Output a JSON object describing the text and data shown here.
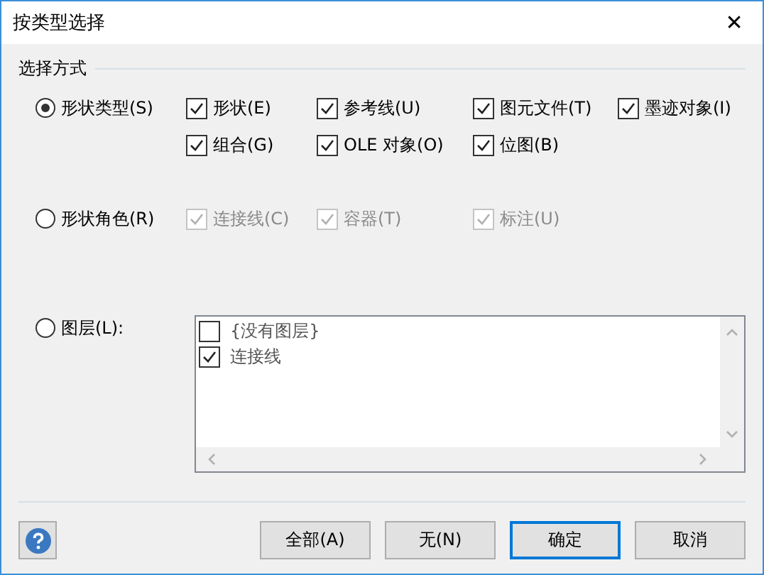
{
  "window": {
    "title": "按类型选择",
    "close": "✕"
  },
  "group": {
    "title": "选择方式"
  },
  "options": [
    {
      "label": "形状类型(S)",
      "selected": true,
      "checkboxes": [
        {
          "label": "形状(E)",
          "checked": true,
          "disabled": false
        },
        {
          "label": "参考线(U)",
          "checked": true,
          "disabled": false
        },
        {
          "label": "图元文件(T)",
          "checked": true,
          "disabled": false
        },
        {
          "label": "墨迹对象(I)",
          "checked": true,
          "disabled": false
        },
        {
          "label": "组合(G)",
          "checked": true,
          "disabled": false
        },
        {
          "label": "OLE 对象(O)",
          "checked": true,
          "disabled": false
        },
        {
          "label": "位图(B)",
          "checked": true,
          "disabled": false
        }
      ]
    },
    {
      "label": "形状角色(R)",
      "selected": false,
      "checkboxes": [
        {
          "label": "连接线(C)",
          "checked": true,
          "disabled": true
        },
        {
          "label": "容器(T)",
          "checked": true,
          "disabled": true
        },
        {
          "label": "标注(U)",
          "checked": true,
          "disabled": true
        }
      ]
    },
    {
      "label": "图层(L):",
      "selected": false,
      "layers": [
        {
          "label": "{没有图层}",
          "checked": false
        },
        {
          "label": "连接线",
          "checked": true
        }
      ]
    }
  ],
  "buttons": [
    {
      "label": "全部(A)",
      "default": false
    },
    {
      "label": "无(N)",
      "default": false
    },
    {
      "label": "确定",
      "default": true
    },
    {
      "label": "取消",
      "default": false
    }
  ]
}
